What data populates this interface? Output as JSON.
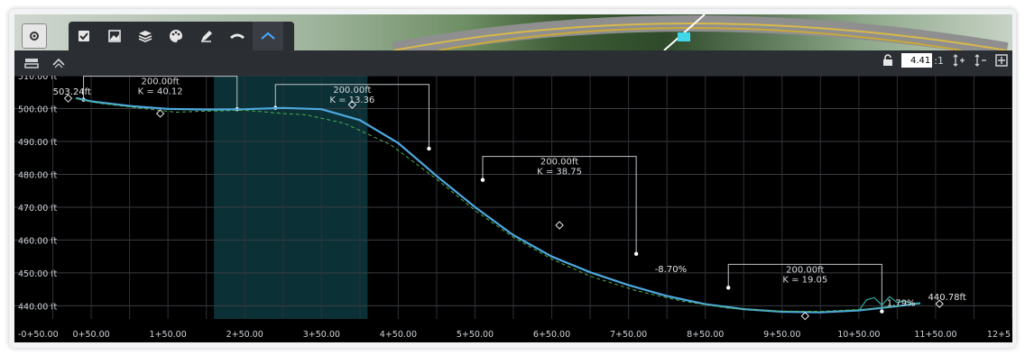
{
  "toolbar": {
    "tabs": [
      {
        "icon": "checkbox-icon"
      },
      {
        "icon": "image-icon"
      },
      {
        "icon": "layers-icon"
      },
      {
        "icon": "palette-icon"
      },
      {
        "icon": "pen-icon"
      },
      {
        "icon": "road-icon"
      },
      {
        "icon": "profile-icon"
      }
    ],
    "scale_value": "4.41",
    "scale_suffix": ":1"
  },
  "chart_data": {
    "type": "line",
    "x_ticks": [
      "-0+50.00",
      "0+50.00",
      "1+50.00",
      "2+50.00",
      "3+50.00",
      "4+50.00",
      "5+50.00",
      "6+50.00",
      "7+50.00",
      "8+50.00",
      "9+50.00",
      "10+50.00",
      "11+50.00",
      "12+5"
    ],
    "y_ticks": [
      "510.00 ft",
      "500.00 ft",
      "490.00 ft",
      "480.00 ft",
      "470.00 ft",
      "460.00 ft",
      "450.00 ft",
      "440.00 ft"
    ],
    "ylim": [
      436,
      510
    ],
    "xlim": [
      -50,
      1250
    ],
    "series": [
      {
        "x": [
          30,
          50,
          100,
          150,
          200,
          250,
          300,
          350,
          400,
          450,
          500,
          550,
          600,
          650,
          700,
          750,
          800,
          850,
          900,
          950,
          1000,
          1050,
          1100,
          1130
        ],
        "y": [
          503.2,
          502.2,
          500.8,
          499.9,
          499.7,
          499.8,
          500.2,
          499.8,
          496.5,
          489.5,
          479.5,
          470.0,
          461.5,
          455.0,
          450.2,
          446.3,
          443.0,
          440.5,
          439.0,
          438.2,
          438.0,
          438.6,
          439.9,
          440.8
        ]
      },
      {
        "x": [
          30,
          60,
          100,
          160,
          200,
          250,
          300,
          330,
          380,
          440,
          500,
          550,
          600,
          650,
          700,
          760,
          820,
          880,
          940,
          1000,
          1060,
          1100,
          1130
        ],
        "y": [
          503.0,
          501.6,
          500.5,
          498.9,
          499.2,
          499.5,
          498.5,
          498.1,
          495.5,
          489.0,
          478.5,
          469.0,
          460.8,
          454.2,
          449.0,
          444.6,
          441.4,
          439.3,
          438.4,
          438.3,
          439.0,
          439.9,
          440.8
        ]
      },
      {
        "x": [
          1050,
          1060,
          1070,
          1080,
          1090,
          1100,
          1110,
          1120,
          1130
        ],
        "y": [
          438.5,
          441.8,
          442.5,
          440.2,
          442.8,
          441.0,
          441.5,
          440.6,
          440.8
        ]
      }
    ],
    "vertical_curves": [
      {
        "start": 40,
        "end": 240,
        "start_elev": 502.7,
        "end_elev": 499.8,
        "label_len": "200.00ft",
        "label_k": "K = 40.12"
      },
      {
        "start": 290,
        "end": 490,
        "start_elev": 500.2,
        "end_elev": 487.8,
        "label_len": "200.00ft",
        "label_k": "K = 13.36"
      },
      {
        "start": 560,
        "end": 760,
        "start_elev": 478.3,
        "end_elev": 455.8,
        "label_len": "200.00ft",
        "label_k": "K = 38.75"
      },
      {
        "start": 880,
        "end": 1080,
        "start_elev": 445.5,
        "end_elev": 438.3,
        "label_len": "200.00ft",
        "label_k": "K = 19.05"
      }
    ],
    "pvi_points": [
      {
        "x": 20,
        "y": 503.1
      },
      {
        "x": 140,
        "y": 498.5
      },
      {
        "x": 390,
        "y": 501.2
      },
      {
        "x": 660,
        "y": 464.5
      },
      {
        "x": 980,
        "y": 436.9
      },
      {
        "x": 1155,
        "y": 440.6
      }
    ],
    "selected_range": {
      "start": 210,
      "end": 410
    },
    "annotations": [
      {
        "x": 25,
        "y": 504.2,
        "text": "503.24ft"
      },
      {
        "x": 1165,
        "y": 441.8,
        "text": "440.78ft"
      },
      {
        "x": 805,
        "y": 450.3,
        "text": "-8.70%"
      },
      {
        "x": 1105,
        "y": 440.0,
        "text": "1.79%"
      }
    ]
  }
}
